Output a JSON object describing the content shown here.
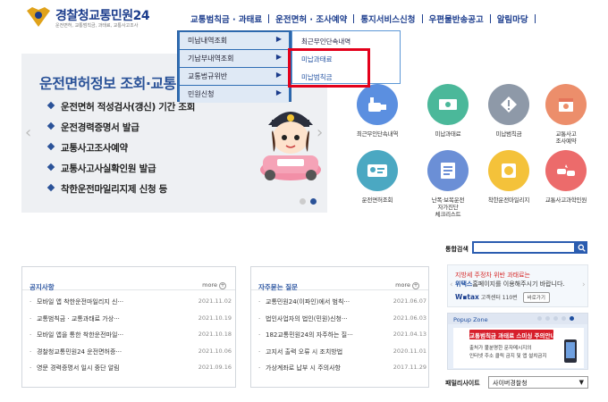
{
  "site": {
    "title_main": "경찰청",
    "title_accent": "교통민원24",
    "subtitle": "운전면허, 교통범칙금, 과태료, 교통사고조사"
  },
  "gnb": [
    "교통범칙금 · 과태료",
    "운전면허 · 조사예약",
    "통지서비스신청",
    "우편물반송공고",
    "알림마당"
  ],
  "dropdown": {
    "items": [
      "미납내역조회",
      "기납부내역조회",
      "교통법규위반",
      "민원신청"
    ],
    "submenu": [
      "최근무인단속내역",
      "미납과태료",
      "미납범칙금"
    ]
  },
  "hero": {
    "title": "운전면허정보 조회·교통",
    "items": [
      "운전면허 적성검사(갱신) 기간 조회",
      "운전경력증명서 발급",
      "교통사고조사예약",
      "교통사고사실확인원 발급",
      "착한운전마일리지제 신청 등"
    ]
  },
  "quick_icons": [
    {
      "label": [
        "최근무인단속내역"
      ],
      "color": "#5b8fe0",
      "icon": "camera-icon"
    },
    {
      "label": [
        "미납과태료"
      ],
      "color": "#4bb89a",
      "icon": "money-icon"
    },
    {
      "label": [
        "미납범칙금"
      ],
      "color": "#8e99a8",
      "icon": "warning-icon"
    },
    {
      "label": [
        "교통사고",
        "조사예약"
      ],
      "color": "#ec8e6b",
      "icon": "calendar-icon"
    },
    {
      "label": [
        "운전면허조회"
      ],
      "color": "#4ba8c2",
      "icon": "license-icon"
    },
    {
      "label": [
        "난폭·보복운전",
        "자가진단",
        "체크리스트"
      ],
      "color": "#6b8fd6",
      "icon": "checklist-icon"
    },
    {
      "label": [
        "착한운전마일리지"
      ],
      "color": "#f4c23a",
      "icon": "mileage-icon"
    },
    {
      "label": [
        "교통사고과학인원"
      ],
      "color": "#ec6b6b",
      "icon": "car-crash-icon"
    }
  ],
  "search": {
    "label": "통합검색",
    "placeholder": ""
  },
  "notice": {
    "title": "공지사항",
    "more": "more",
    "rows": [
      {
        "text": "모바일 앱 착한운전마일리지 신···",
        "date": "2021.11.02"
      },
      {
        "text": "교통범칙금 · 교통과태료 가상···",
        "date": "2021.10.19"
      },
      {
        "text": "모바일 앱을 통한 착한운전마일···",
        "date": "2021.10.18"
      },
      {
        "text": "경찰청교통민원24 운전면허증···",
        "date": "2021.10.06"
      },
      {
        "text": "영문 경력증명서 일시 중단 알림",
        "date": "2021.09.16"
      }
    ]
  },
  "faq": {
    "title": "자주묻는 질문",
    "more": "more",
    "rows": [
      {
        "text": "교통민원24(이파인)에서 범칙···",
        "date": "2021.06.07"
      },
      {
        "text": "법인사업자의 법인(민원)신청···",
        "date": "2021.06.03"
      },
      {
        "text": "182교통민원24의 자주하는 질···",
        "date": "2021.04.13"
      },
      {
        "text": "고지서 출력 오류 시 조치방법",
        "date": "2020.11.01"
      },
      {
        "text": "가상계좌로 납부 시 주의사항",
        "date": "2017.11.29"
      }
    ]
  },
  "banner": {
    "line1_red": "지방세 주정차 위반 과태료는",
    "line2_pre": "",
    "line2_blue": "위택스",
    "line2_post": "홈페이지를 이용해주시기 바랍니다.",
    "logo": "W▪tax",
    "phone": "고객센터 110번",
    "button": "바로가기"
  },
  "popup": {
    "title": "Popup Zone",
    "pill": "교통범칙금 과태료 스미싱 주의안내",
    "line1": "출처가 불분명한 문자메시지의",
    "line2": "인터넷 주소 클릭 금지 및 앱 설치금지"
  },
  "family": {
    "label": "패밀리사이트",
    "value": "사이버경찰청"
  }
}
